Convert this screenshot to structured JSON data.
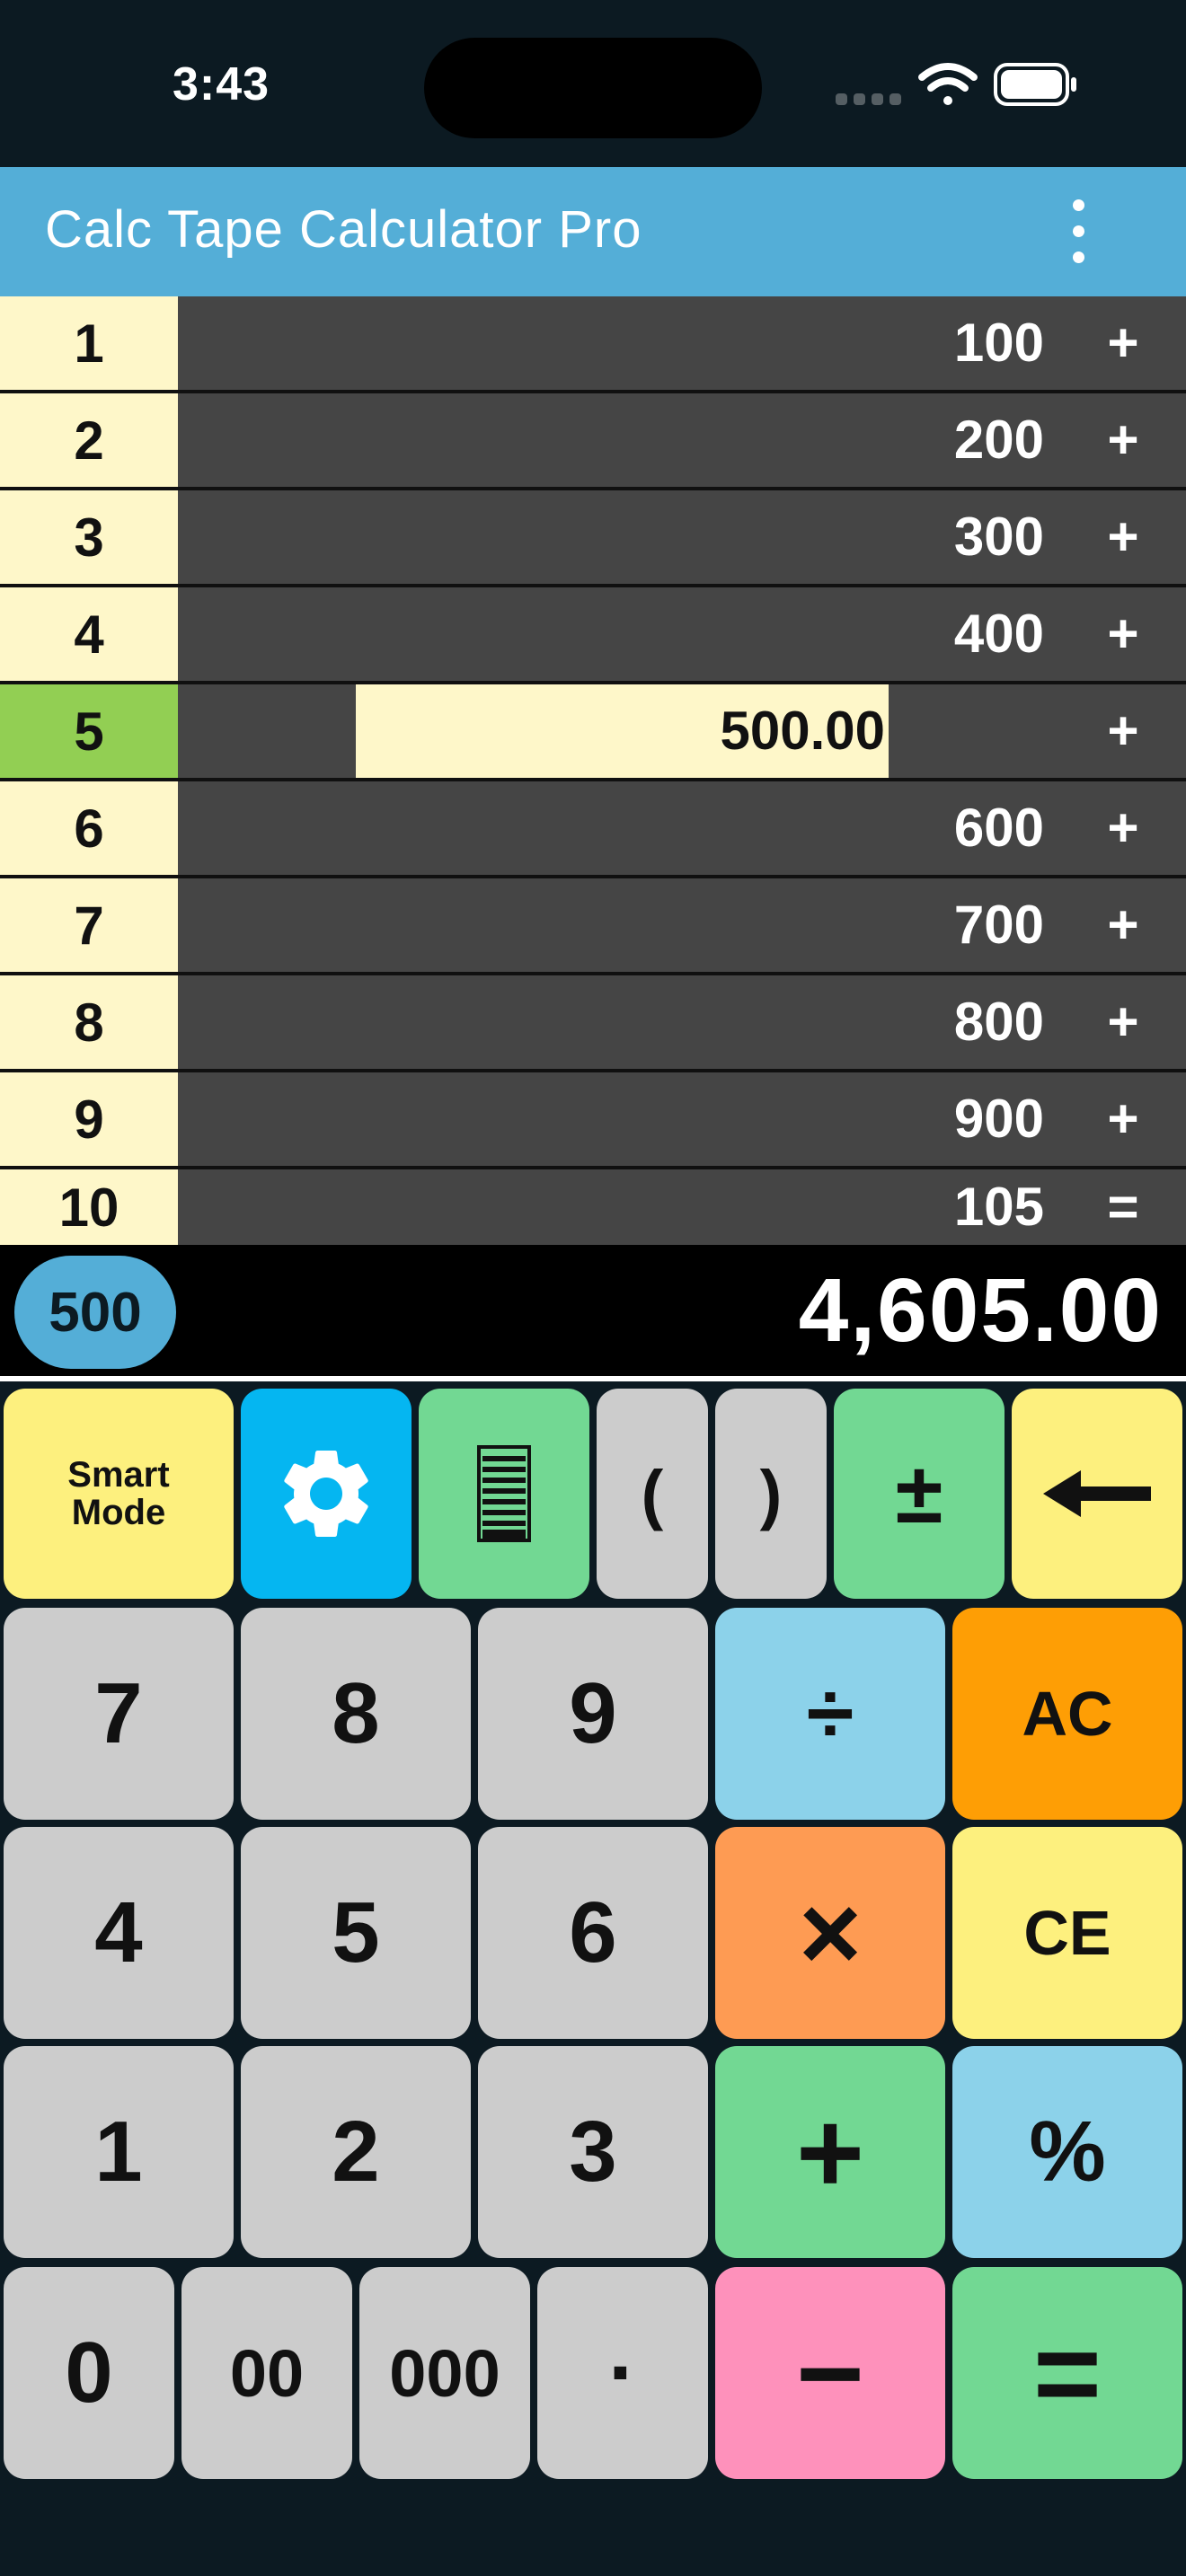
{
  "status_bar": {
    "time": "3:43"
  },
  "app_bar": {
    "title": "Calc Tape Calculator Pro",
    "menu_icon": "more-vertical-icon"
  },
  "tape": {
    "rows": [
      {
        "num": "1",
        "value": "100",
        "op": "+"
      },
      {
        "num": "2",
        "value": "200",
        "op": "+"
      },
      {
        "num": "3",
        "value": "300",
        "op": "+"
      },
      {
        "num": "4",
        "value": "400",
        "op": "+"
      },
      {
        "num": "5",
        "value": "500.00",
        "op": "+"
      },
      {
        "num": "6",
        "value": "600",
        "op": "+"
      },
      {
        "num": "7",
        "value": "700",
        "op": "+"
      },
      {
        "num": "8",
        "value": "800",
        "op": "+"
      },
      {
        "num": "9",
        "value": "900",
        "op": "+"
      },
      {
        "num": "10",
        "value": "105",
        "op": "="
      }
    ],
    "active_row": 5
  },
  "total_bar": {
    "memory": "500",
    "total": "4,605.00"
  },
  "keypad": {
    "smart_mode": "Smart\nMode",
    "open_paren": "(",
    "close_paren": ")",
    "plus_minus": "±",
    "seven": "7",
    "eight": "8",
    "nine": "9",
    "divide": "÷",
    "all_clear": "AC",
    "four": "4",
    "five": "5",
    "six": "6",
    "multiply": "×",
    "clear_entry": "CE",
    "one": "1",
    "two": "2",
    "three": "3",
    "plus": "+",
    "percent": "%",
    "zero": "0",
    "double_zero": "00",
    "triple_zero": "000",
    "decimal": "·",
    "minus": "−",
    "equals": "="
  },
  "colors": {
    "background": "#0c1a22",
    "app_bar": "#54aed7",
    "tape_number_bg": "#fef7c9",
    "active_row": "#92cf53",
    "tape_body": "#454545",
    "key_gray": "#cccccc",
    "key_yellow": "#fdf07e",
    "key_blue": "#05b6f1",
    "key_green": "#72d893",
    "key_sky": "#8cd2ea",
    "key_orange": "#fe9e05",
    "key_salmon": "#fe9b53",
    "key_pink": "#fe91bb"
  }
}
